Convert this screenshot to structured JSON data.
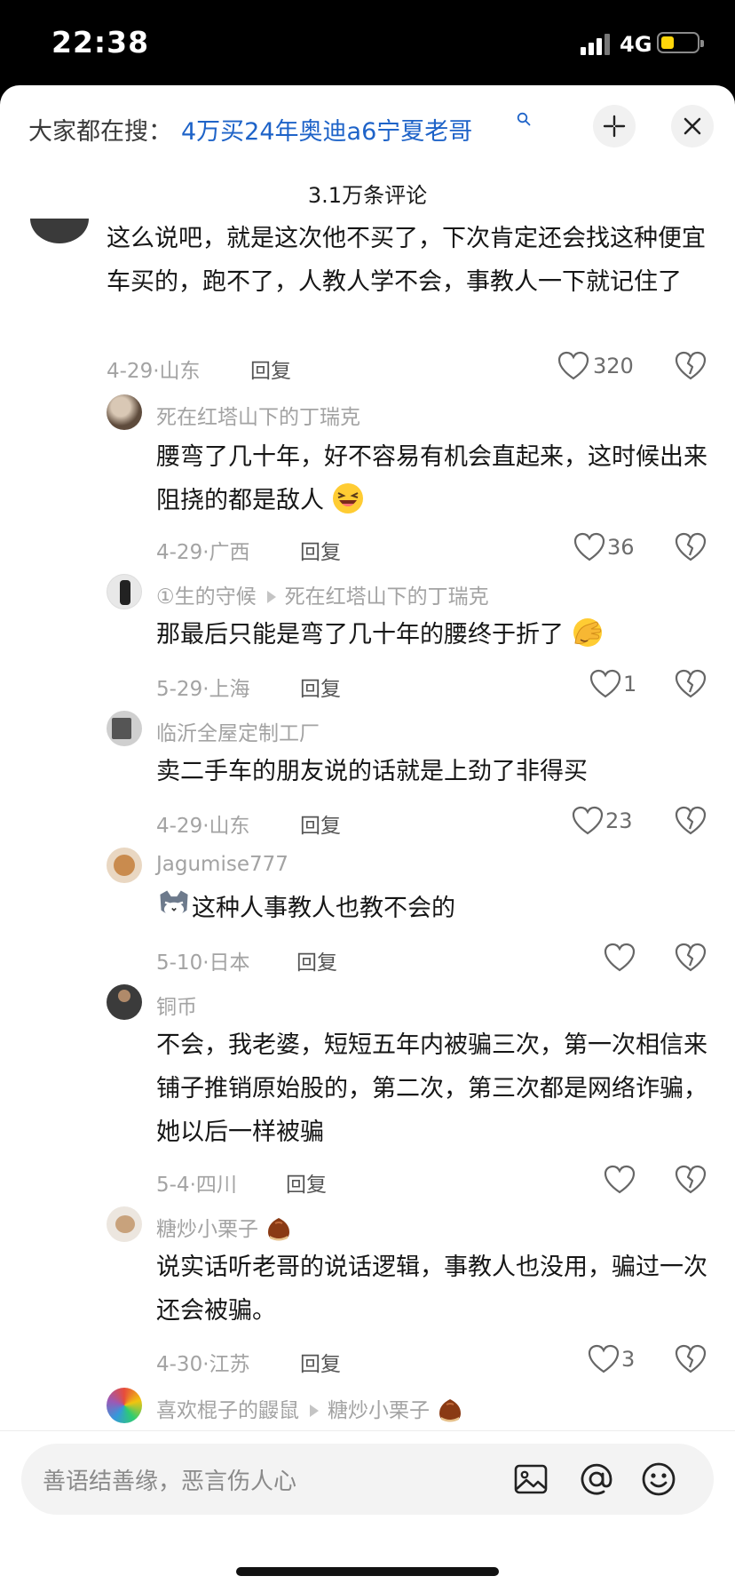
{
  "status": {
    "time": "22:38",
    "network": "4G"
  },
  "header": {
    "search_prefix": "大家都在搜：",
    "search_query": "4万买24年奥迪a6宁夏老哥",
    "comment_count": "3.1万条评论"
  },
  "comments": [
    {
      "user": "",
      "text": "这么说吧，就是这次他不买了，下次肯定还会找这种便宜车买的，跑不了，人教人学不会，事教人一下就记住了",
      "date": "4-29·山东",
      "reply": "回复",
      "likes": "320"
    },
    {
      "user": "死在红塔山下的丁瑞克",
      "text": "腰弯了几十年，好不容易有机会直起来，这时候出来阻挠的都是敌人",
      "date": "4-29·广西",
      "reply": "回复",
      "likes": "36"
    },
    {
      "user": "①生的守候",
      "reply_to": "死在红塔山下的丁瑞克",
      "text": "那最后只能是弯了几十年的腰终于折了",
      "date": "5-29·上海",
      "reply": "回复",
      "likes": "1"
    },
    {
      "user": "临沂全屋定制工厂",
      "text": "卖二手车的朋友说的话就是上劲了非得买",
      "date": "4-29·山东",
      "reply": "回复",
      "likes": "23"
    },
    {
      "user": "Jagumise777",
      "text": "这种人事教人也教不会的",
      "date": "5-10·日本",
      "reply": "回复",
      "likes": ""
    },
    {
      "user": "铜币",
      "text": "不会，我老婆，短短五年内被骗三次，第一次相信来铺子推销原始股的，第二次，第三次都是网络诈骗，她以后一样被骗",
      "date": "5-4·四川",
      "reply": "回复",
      "likes": ""
    },
    {
      "user": "糖炒小栗子",
      "text": "说实话听老哥的说话逻辑，事教人也没用，骗过一次还会被骗。",
      "date": "4-30·江苏",
      "reply": "回复",
      "likes": "3"
    },
    {
      "user": "喜欢棍子的鼹鼠",
      "reply_to": "糖炒小栗子",
      "text": "",
      "date": "",
      "reply": "",
      "likes": ""
    }
  ],
  "composer": {
    "placeholder": "善语结善缘，恶言伤人心"
  },
  "colors": {
    "link": "#1e63c8",
    "battery": "#ffd60a",
    "muted": "#a3a3a3"
  },
  "icons": [
    "signal-icon",
    "battery-icon",
    "search-icon",
    "expand-icon",
    "close-icon",
    "heart-icon",
    "broken-heart-icon",
    "image-icon",
    "at-icon",
    "emoji-icon"
  ]
}
